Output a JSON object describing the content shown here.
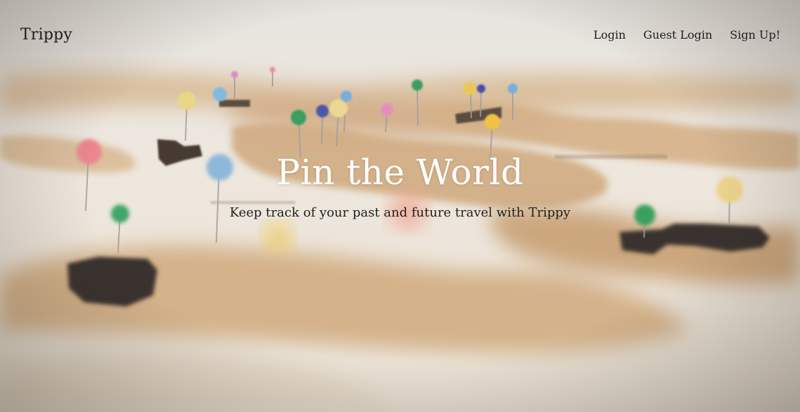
{
  "navbar": {
    "brand": "Trippy",
    "links": [
      {
        "label": "Login"
      },
      {
        "label": "Guest Login"
      },
      {
        "label": "Sign Up!"
      }
    ]
  },
  "hero": {
    "headline": "Pin the World",
    "tagline": "Keep track of your past and future travel with Trippy",
    "background_image": "blurred-world-map-with-push-pins",
    "colors": {
      "headline_text": "#ffffff",
      "body_text": "#1c1c1c",
      "map_paper": "#efeae2",
      "map_land": "#c9a57a"
    }
  }
}
